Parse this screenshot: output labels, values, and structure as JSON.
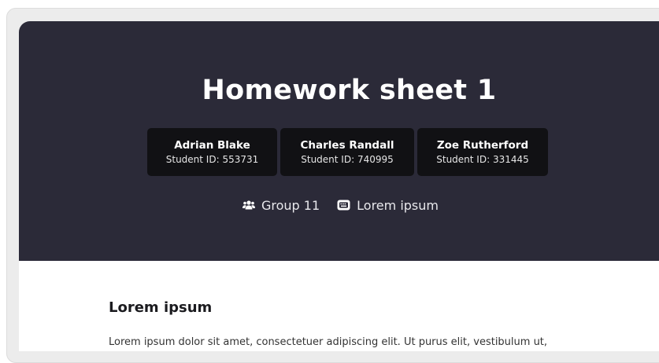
{
  "title": "Homework sheet 1",
  "students": [
    {
      "name": "Adrian Blake",
      "id": "Student ID: 553731"
    },
    {
      "name": "Charles Randall",
      "id": "Student ID: 740995"
    },
    {
      "name": "Zoe Rutherford",
      "id": "Student ID: 331445"
    }
  ],
  "meta": {
    "group_label": "Group 11",
    "course_label": "Lorem ipsum",
    "group_icon": "users-icon",
    "course_icon": "keyboard-icon"
  },
  "section": {
    "heading": "Lorem ipsum",
    "paragraph": "Lorem ipsum dolor sit amet, consectetuer adipiscing elit. Ut purus elit, vestibulum ut,"
  },
  "colors": {
    "header_bg": "#2b2a38",
    "student_box_bg": "#111114",
    "page_bg": "#ffffff"
  }
}
